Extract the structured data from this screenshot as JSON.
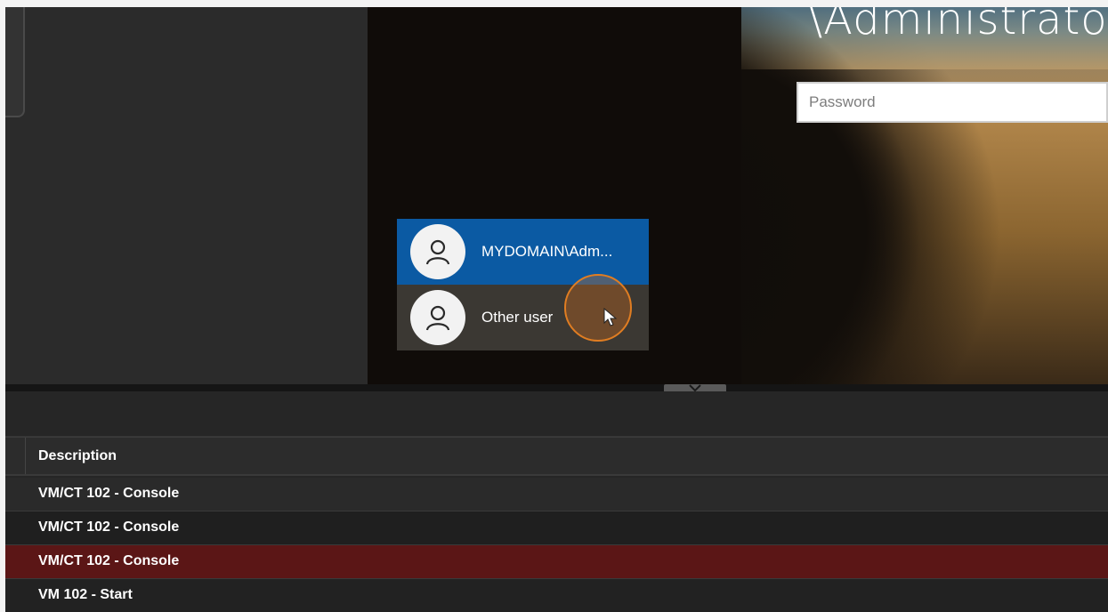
{
  "console": {
    "user_title": "\\Administrato",
    "password_placeholder": "Password",
    "users": [
      {
        "name": "MYDOMAIN\\Adm...",
        "selected": true,
        "icon": "user-icon"
      },
      {
        "name": "Other user",
        "selected": false,
        "icon": "user-icon"
      }
    ]
  },
  "tasks": {
    "columns": [
      "Description"
    ],
    "rows": [
      {
        "description": "VM/CT 102 - Console",
        "status": "normal"
      },
      {
        "description": "VM/CT 102 - Console",
        "status": "normal"
      },
      {
        "description": "VM/CT 102 - Console",
        "status": "error"
      },
      {
        "description": "VM 102 - Start",
        "status": "normal"
      }
    ]
  },
  "colors": {
    "selected_user": "#0b5aa3",
    "error_row": "#5b1616",
    "cursor_highlight": "#e07d22"
  }
}
